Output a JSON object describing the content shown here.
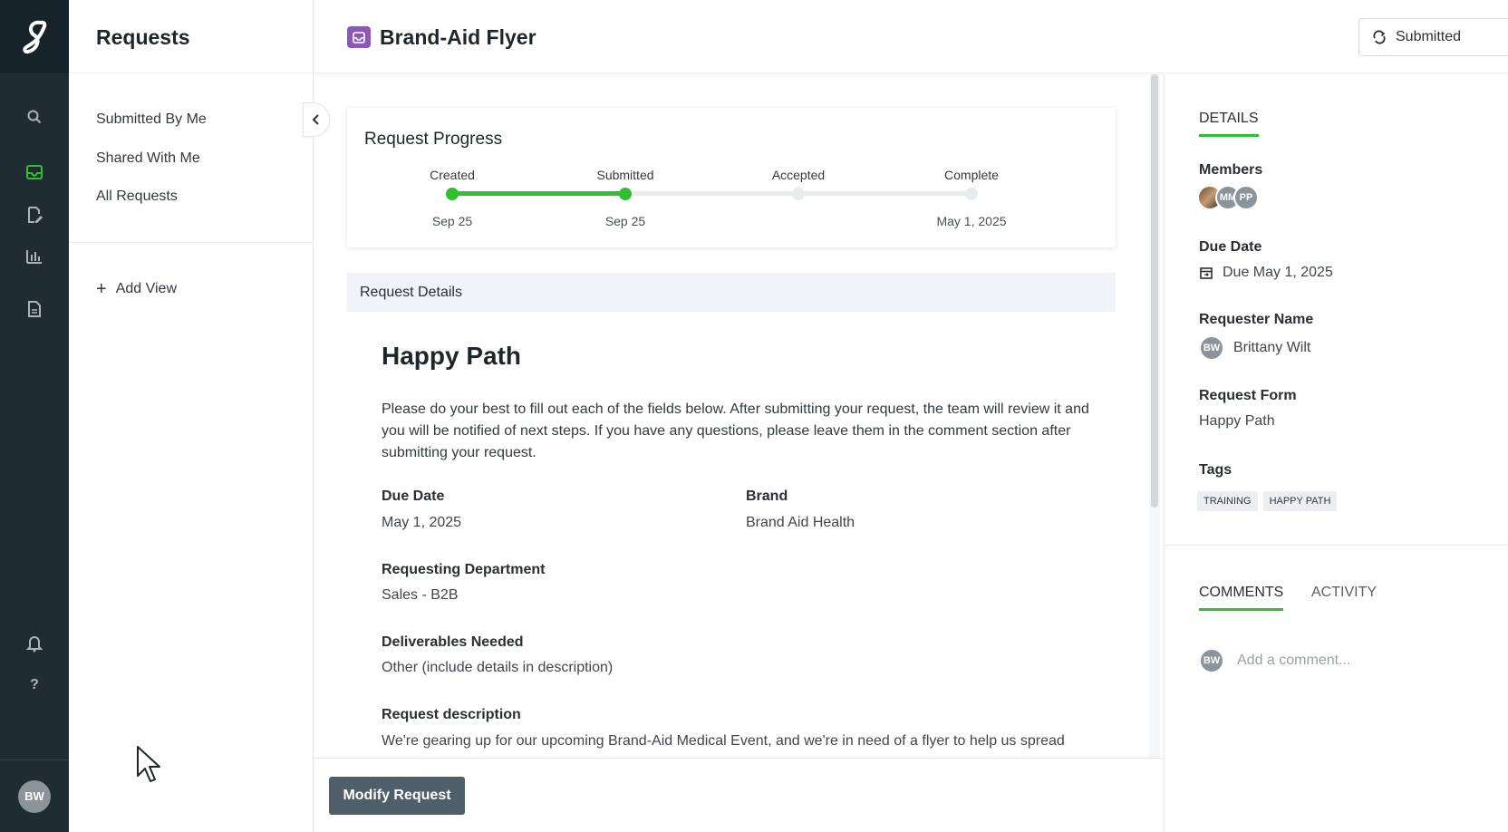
{
  "app": {
    "user_initials": "BW"
  },
  "sidebar": {
    "title": "Requests",
    "nav": [
      {
        "label": "Submitted By Me"
      },
      {
        "label": "Shared With Me"
      },
      {
        "label": "All Requests"
      }
    ],
    "add_view_label": "Add View"
  },
  "header": {
    "title": "Brand-Aid Flyer",
    "status_label": "Submitted"
  },
  "progress": {
    "title": "Request Progress",
    "steps": [
      {
        "label": "Created",
        "date": "Sep 25",
        "done": true
      },
      {
        "label": "Submitted",
        "date": "Sep 25",
        "done": true
      },
      {
        "label": "Accepted",
        "date": "",
        "done": false
      },
      {
        "label": "Complete",
        "date": "May 1, 2025",
        "done": false
      }
    ]
  },
  "details": {
    "section_label": "Request Details",
    "form_title": "Happy Path",
    "description": "Please do your best to fill out each of the fields below. After submitting your request, the team will review it and you will be notified of next steps. If you have any questions, please leave them in the comment section after submitting your request.",
    "fields": {
      "due_date": {
        "label": "Due Date",
        "value": "May 1, 2025"
      },
      "brand": {
        "label": "Brand",
        "value": "Brand Aid Health"
      },
      "department": {
        "label": "Requesting Department",
        "value": "Sales - B2B"
      },
      "deliverables": {
        "label": "Deliverables Needed",
        "value": "Other (include details in description)"
      },
      "request_description": {
        "label": "Request description",
        "value": "We're gearing up for our upcoming Brand-Aid Medical Event, and we're in need of a flyer to help us spread"
      }
    }
  },
  "footer": {
    "modify_label": "Modify Request"
  },
  "right_panel": {
    "tab_details": "DETAILS",
    "members_label": "Members",
    "members": [
      "MM",
      "PP"
    ],
    "due_label": "Due Date",
    "due_value": "Due May 1, 2025",
    "requester_label": "Requester Name",
    "requester_initials": "BW",
    "requester_name": "Brittany Wilt",
    "form_label": "Request Form",
    "form_value": "Happy Path",
    "tags_label": "Tags",
    "tags": [
      "TRAINING",
      "HAPPY PATH"
    ],
    "tab_comments": "COMMENTS",
    "tab_activity": "ACTIVITY",
    "comment_initials": "BW",
    "comment_placeholder": "Add a comment..."
  },
  "colors": {
    "accent": "#2fbf31",
    "rail_bg": "#1f2d33",
    "request_icon": "#8b57b8",
    "button_bg": "#4f5f6a"
  }
}
